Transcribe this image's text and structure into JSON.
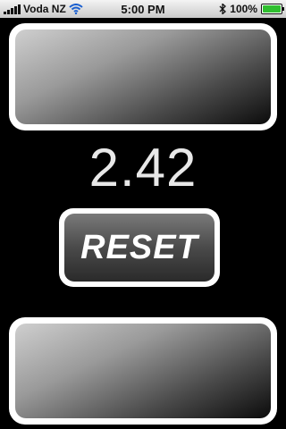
{
  "status_bar": {
    "carrier": "Voda NZ",
    "time": "5:00 PM",
    "battery_percent": "100%",
    "battery_level": 1.0,
    "icons": [
      "signal-icon",
      "wifi-icon",
      "bluetooth-icon",
      "battery-icon"
    ]
  },
  "timer": {
    "value": "2.42"
  },
  "reset_button": {
    "label": "RESET"
  },
  "colors": {
    "background": "#000000",
    "pad_border": "#ffffff",
    "timer_text": "#e8e8e8",
    "battery_fill": "#2fbf2f"
  }
}
